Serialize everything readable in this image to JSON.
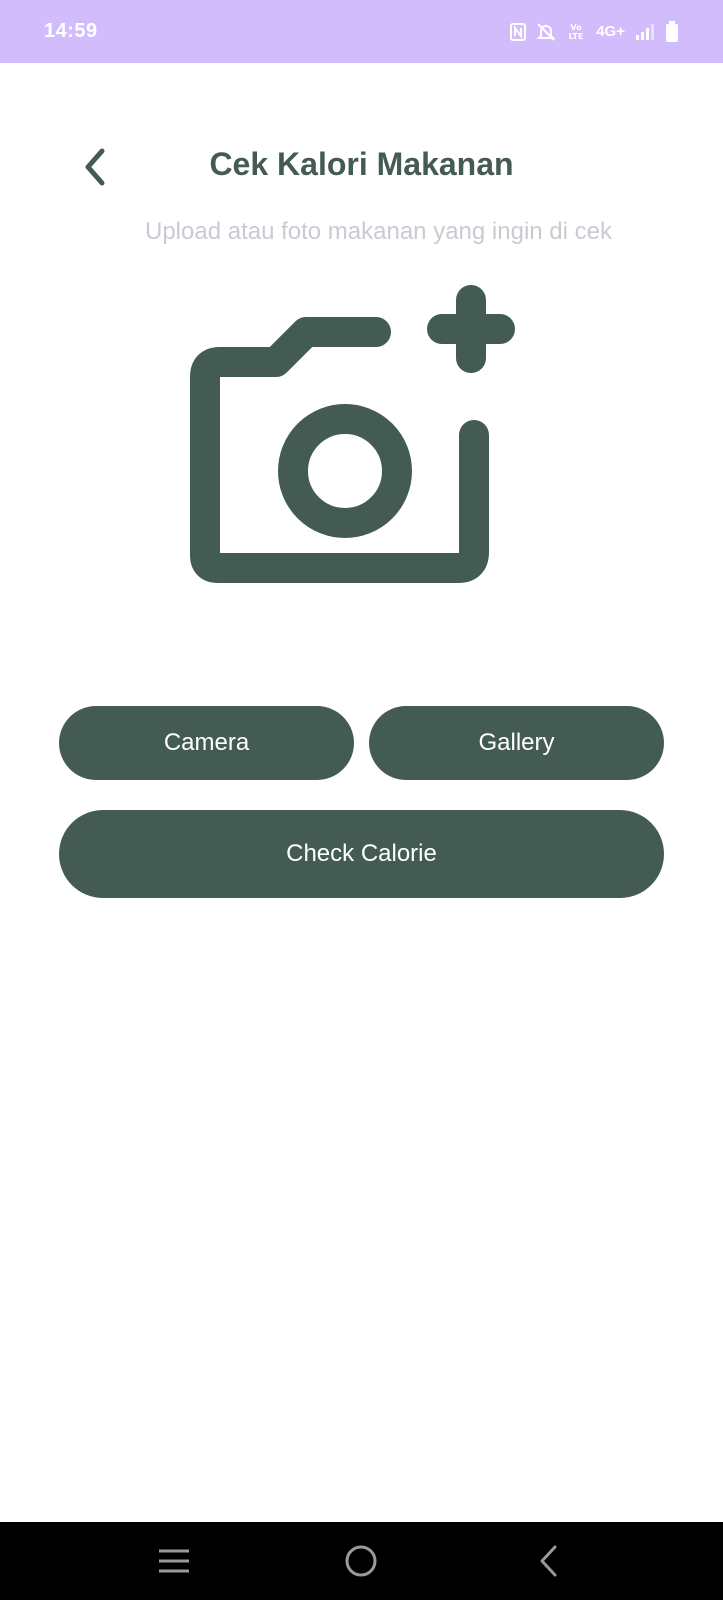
{
  "status_bar": {
    "time": "14:59",
    "network_label": "4G+",
    "volte_label": "Vo)) LTE",
    "icons": [
      "nfc-icon",
      "mute-icon",
      "volte-icon",
      "signal-icon",
      "battery-icon"
    ]
  },
  "header": {
    "title": "Cek Kalori Makanan",
    "subtitle": "Upload atau foto makanan yang ingin di cek"
  },
  "illustration": {
    "icon": "add-photo-camera-icon"
  },
  "actions": {
    "camera_label": "Camera",
    "gallery_label": "Gallery",
    "check_label": "Check Calorie"
  },
  "nav_bar": {
    "icons": [
      "recents-icon",
      "home-icon",
      "back-icon"
    ]
  },
  "colors": {
    "primary": "#435b53",
    "status_bar": "#d3bcfc",
    "subtitle": "#c8cbd1",
    "nav_bar": "#000000"
  }
}
